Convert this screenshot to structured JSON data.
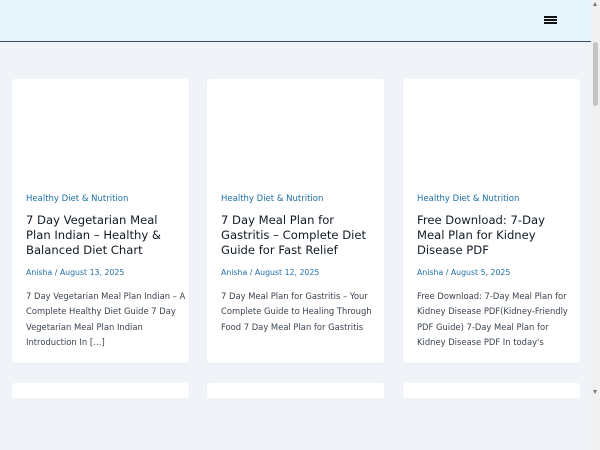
{
  "header": {
    "menu_icon": "hamburger-menu-icon"
  },
  "posts": [
    {
      "category": "Healthy Diet & Nutrition",
      "title": "7 Day Vegetarian Meal Plan Indian – Healthy & Balanced Diet Chart",
      "author": "Anisha",
      "date": "August 13, 2025",
      "excerpt": "7 Day Vegetarian Meal Plan Indian – A Complete Healthy Diet Guide 7 Day Vegetarian Meal Plan Indian Introduction In […]"
    },
    {
      "category": "Healthy Diet & Nutrition",
      "title": "7 Day Meal Plan for Gastritis – Complete Diet Guide for Fast Relief",
      "author": "Anisha",
      "date": "August 12, 2025",
      "excerpt": "7 Day Meal Plan for Gastritis – Your Complete Guide to Healing Through Food 7 Day Meal Plan for Gastritis"
    },
    {
      "category": "Healthy Diet & Nutrition",
      "title": "Free Download: 7-Day Meal Plan for Kidney Disease PDF",
      "author": "Anisha",
      "date": "August 5, 2025",
      "excerpt": "Free Download: 7-Day Meal Plan for Kidney Disease PDF(Kidney-Friendly PDF Guide) 7-Day Meal Plan for Kidney Disease PDF In today's"
    }
  ],
  "meta_separator": " / "
}
